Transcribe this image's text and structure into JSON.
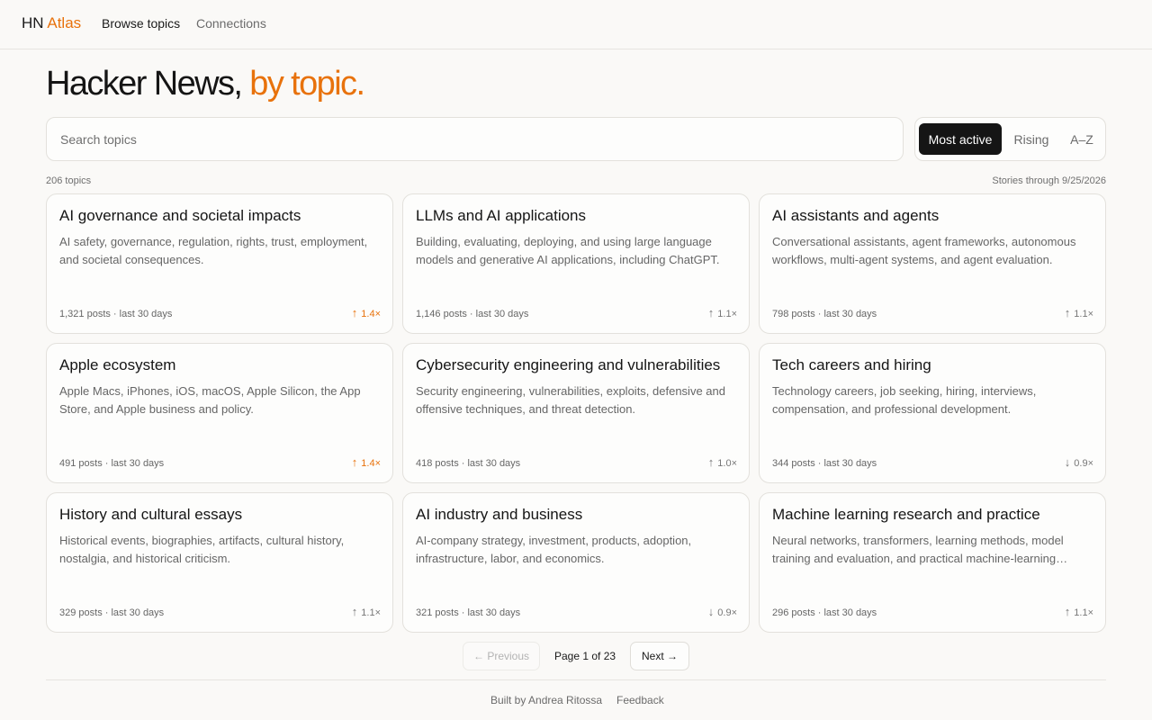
{
  "nav": {
    "brand_prefix": "HN",
    "brand_accent": "Atlas",
    "links": [
      "Browse topics",
      "Connections"
    ]
  },
  "hero": {
    "title_main": "Hacker News,",
    "title_accent": "by topic."
  },
  "search": {
    "placeholder": "Search topics",
    "value": ""
  },
  "sort": {
    "options": [
      "Most active",
      "Rising",
      "A–Z"
    ],
    "selected": "Most active"
  },
  "meta": {
    "topic_count": "206 topics",
    "stories_through": "Stories through 9/25/2026"
  },
  "colors": {
    "accent": "#e8720c",
    "background": "#faf9f7",
    "card_border": "#e3e1dc"
  },
  "cards": [
    {
      "title": "AI governance and societal impacts",
      "desc": "AI safety, governance, regulation, rights, trust, employment, and societal consequences.",
      "posts": "1,321 posts · last 30 days",
      "arrow": "↑",
      "trend": "1.4×",
      "hot": true
    },
    {
      "title": "LLMs and AI applications",
      "desc": "Building, evaluating, deploying, and using large language models and generative AI applications, including ChatGPT.",
      "posts": "1,146 posts · last 30 days",
      "arrow": "↑",
      "trend": "1.1×",
      "hot": false
    },
    {
      "title": "AI assistants and agents",
      "desc": "Conversational assistants, agent frameworks, autonomous workflows, multi-agent systems, and agent evaluation.",
      "posts": "798 posts · last 30 days",
      "arrow": "↑",
      "trend": "1.1×",
      "hot": false
    },
    {
      "title": "Apple ecosystem",
      "desc": "Apple Macs, iPhones, iOS, macOS, Apple Silicon, the App Store, and Apple business and policy.",
      "posts": "491 posts · last 30 days",
      "arrow": "↑",
      "trend": "1.4×",
      "hot": true
    },
    {
      "title": "Cybersecurity engineering and vulnerabilities",
      "desc": "Security engineering, vulnerabilities, exploits, defensive and offensive techniques, and threat detection.",
      "posts": "418 posts · last 30 days",
      "arrow": "↑",
      "trend": "1.0×",
      "hot": false
    },
    {
      "title": "Tech careers and hiring",
      "desc": "Technology careers, job seeking, hiring, interviews, compensation, and professional development.",
      "posts": "344 posts · last 30 days",
      "arrow": "↓",
      "trend": "0.9×",
      "hot": false
    },
    {
      "title": "History and cultural essays",
      "desc": "Historical events, biographies, artifacts, cultural history, nostalgia, and historical criticism.",
      "posts": "329 posts · last 30 days",
      "arrow": "↑",
      "trend": "1.1×",
      "hot": false
    },
    {
      "title": "AI industry and business",
      "desc": "AI-company strategy, investment, products, adoption, infrastructure, labor, and economics.",
      "posts": "321 posts · last 30 days",
      "arrow": "↓",
      "trend": "0.9×",
      "hot": false
    },
    {
      "title": "Machine learning research and practice",
      "desc": "Neural networks, transformers, learning methods, model training and evaluation, and practical machine-learning…",
      "posts": "296 posts · last 30 days",
      "arrow": "↑",
      "trend": "1.1×",
      "hot": false
    }
  ],
  "pagination": {
    "prev": "← Previous",
    "label": "Page 1 of 23",
    "next": "Next →"
  },
  "footer": {
    "built": "Built by Andrea Ritossa",
    "feedback": "Feedback"
  }
}
